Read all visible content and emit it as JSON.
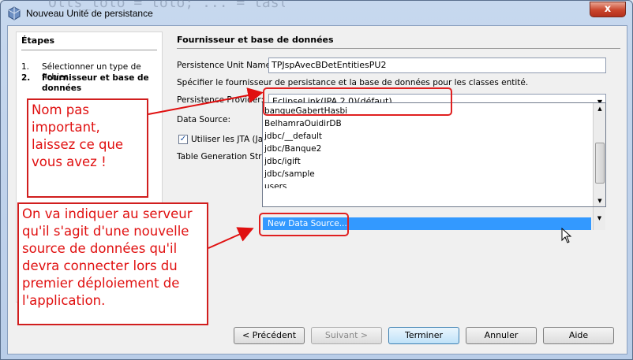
{
  "window": {
    "title": "Nouveau Unité de persistance",
    "close_label": "x",
    "background_code": "Olls_lolo = lolo; ... = lastName;"
  },
  "steps": {
    "header": "Étapes",
    "items": [
      {
        "num": "1.",
        "label": "Sélectionner un type de fichier"
      },
      {
        "num": "2.",
        "label": "Fournisseur et base de données"
      }
    ]
  },
  "main": {
    "header": "Fournisseur et base de données",
    "unit_name_label": "Persistence Unit Name:",
    "unit_name_value": "TPJspAvecBDetEntitiesPU2",
    "description": "Spécifier le fournisseur de persistance et la base de données pour les classes entité.",
    "provider_label": "Persistence Provider:",
    "provider_value": "EclipseLink(JPA 2.0)(défaut)",
    "datasource_label": "Data Source:",
    "datasource_value": "",
    "jta_label": "Utiliser les  JTA (Java",
    "jta_checked": true,
    "table_strategy_label": "Table Generation Strate"
  },
  "datasource_options": [
    "banqueGabertHasbi",
    "BelhamraOuidirDB",
    "jdbc/__default",
    "jdbc/Banque2",
    "jdbc/igift",
    "jdbc/sample",
    "users",
    "New Data Source..."
  ],
  "selected_option_index": 7,
  "buttons": {
    "previous": "< Précédent",
    "next": "Suivant >",
    "finish": "Terminer",
    "cancel": "Annuler",
    "help": "Aide"
  },
  "annotations": {
    "note1": "Nom pas important, laissez ce que vous avez !",
    "note2": "On va indiquer au serveur qu'il s'agit d'une nouvelle source de données qu'il devra connecter lors du premier déploiement de l'application."
  },
  "colors": {
    "annotation_red": "#e01010",
    "selection_blue": "#3399ff"
  }
}
